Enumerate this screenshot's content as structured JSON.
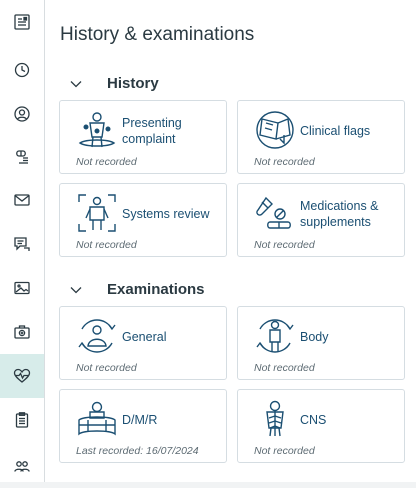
{
  "sidebar": {
    "items": [
      {
        "icon": "summary-icon"
      },
      {
        "icon": "clock-icon"
      },
      {
        "icon": "contacts-icon"
      },
      {
        "icon": "pill-icon"
      },
      {
        "icon": "envelope-icon"
      },
      {
        "icon": "chat-notes-icon"
      },
      {
        "icon": "image-icon"
      },
      {
        "icon": "medical-kit-icon"
      },
      {
        "icon": "heartbeat-icon",
        "active": true
      },
      {
        "icon": "clipboard-icon"
      },
      {
        "icon": "people-icon"
      }
    ]
  },
  "page": {
    "title": "History & examinations"
  },
  "sections": [
    {
      "title": "History",
      "cards": [
        {
          "label": "Presenting complaint",
          "status": "Not recorded",
          "icon": "presenting-complaint-icon"
        },
        {
          "label": "Clinical flags",
          "status": "Not recorded",
          "icon": "clinical-flags-icon"
        },
        {
          "label": "Systems review",
          "status": "Not recorded",
          "icon": "systems-review-icon"
        },
        {
          "label": "Medications & supplements",
          "status": "Not recorded",
          "icon": "medications-icon"
        }
      ]
    },
    {
      "title": "Examinations",
      "cards": [
        {
          "label": "General",
          "status": "Not recorded",
          "icon": "general-exam-icon"
        },
        {
          "label": "Body",
          "status": "Not recorded",
          "icon": "body-exam-icon"
        },
        {
          "label": "D/M/R",
          "status": "Last recorded: 16/07/2024",
          "icon": "dmr-icon"
        },
        {
          "label": "CNS",
          "status": "Not recorded",
          "icon": "cns-icon"
        }
      ]
    }
  ],
  "colors": {
    "accent": "#1b4f72",
    "active_nav": "#d7ecea",
    "icon": "#1b4f72"
  }
}
